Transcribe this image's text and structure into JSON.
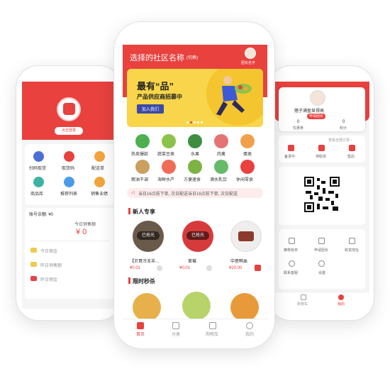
{
  "left": {
    "login_label": "点击登录",
    "grid": [
      {
        "label": "扫码取货",
        "color": "#4c6fd6",
        "icon": "scan-icon"
      },
      {
        "label": "取货码",
        "color": "#e8413e",
        "icon": "code-icon"
      },
      {
        "label": "配送单",
        "color": "#f2a33a",
        "icon": "delivery-icon"
      },
      {
        "label": "商品库",
        "color": "#3bb3a3",
        "icon": "goods-icon"
      },
      {
        "label": "推荐列表",
        "color": "#4c9be8",
        "icon": "recommend-icon"
      },
      {
        "label": "销售业绩",
        "color": "#f2a33a",
        "icon": "sales-icon"
      }
    ],
    "balance_label": "账号余额: ¥0",
    "today_sales_label": "今日销售额",
    "today_sales_value": "¥ 0",
    "stats": [
      {
        "label": "今日佣金"
      },
      {
        "label": "昨日销售额"
      },
      {
        "label": "昨日佣金"
      }
    ]
  },
  "center": {
    "community_title": "选择的社区名称",
    "switch_label": "(切换)",
    "leader_label": "团长名字",
    "banner": {
      "headline": "最有“品”",
      "subline": "产品供应商招募中",
      "button": "加入我们"
    },
    "categories": [
      {
        "label": "热卖爆款",
        "color": "#4caf50"
      },
      {
        "label": "蔬菜豆类",
        "color": "#8bc34a"
      },
      {
        "label": "水果",
        "color": "#3e8e41"
      },
      {
        "label": "肉禽",
        "color": "#e57373"
      },
      {
        "label": "蛋类",
        "color": "#f0a04b"
      },
      {
        "label": "粮油干调",
        "color": "#c9a060"
      },
      {
        "label": "海鲜水产",
        "color": "#ef6c57"
      },
      {
        "label": "方便速食",
        "color": "#7cb342"
      },
      {
        "label": "酒水乳饮",
        "color": "#66bb6a"
      },
      {
        "label": "休闲零食",
        "color": "#e8413e"
      }
    ],
    "notice": "当日16点前下单, 次日配送当日16点前下单, 次日配送",
    "new_section": "新人专享",
    "products": [
      {
        "name": "【贝哥冷冻羊...",
        "price": "¥0.01",
        "badge": "已抢光",
        "color": "#6a5a4a"
      },
      {
        "name": "草莓",
        "price": "¥0.01",
        "badge": "已抢光",
        "color": "#d73a3a"
      },
      {
        "name": "中意鸭血",
        "price": "¥20.00",
        "badge": "",
        "color": "#8a3b2b"
      }
    ],
    "flash_section": "限时秒杀",
    "tabs": [
      {
        "label": "首页",
        "icon": "home-icon"
      },
      {
        "label": "分类",
        "icon": "category-icon"
      },
      {
        "label": "购物车",
        "icon": "cart-icon"
      },
      {
        "label": "我的",
        "icon": "user-icon"
      }
    ]
  },
  "right": {
    "name_label": "猪子满盈显得高",
    "tag_label": "申请团长",
    "stats": [
      {
        "value": "0",
        "label": "优惠券"
      },
      {
        "value": "0",
        "label": "积分"
      }
    ],
    "orders_link": "查看全部订单 ›",
    "order_items": [
      {
        "label": "备货中"
      },
      {
        "label": "待取货"
      },
      {
        "label": "售后"
      }
    ],
    "services": [
      {
        "label": "推荐有奖"
      },
      {
        "label": "申请团长"
      },
      {
        "label": "收货地址"
      },
      {
        "label": "联系客服"
      },
      {
        "label": "设置"
      }
    ],
    "tabs": [
      {
        "label": "购物车"
      },
      {
        "label": "我的"
      }
    ]
  }
}
